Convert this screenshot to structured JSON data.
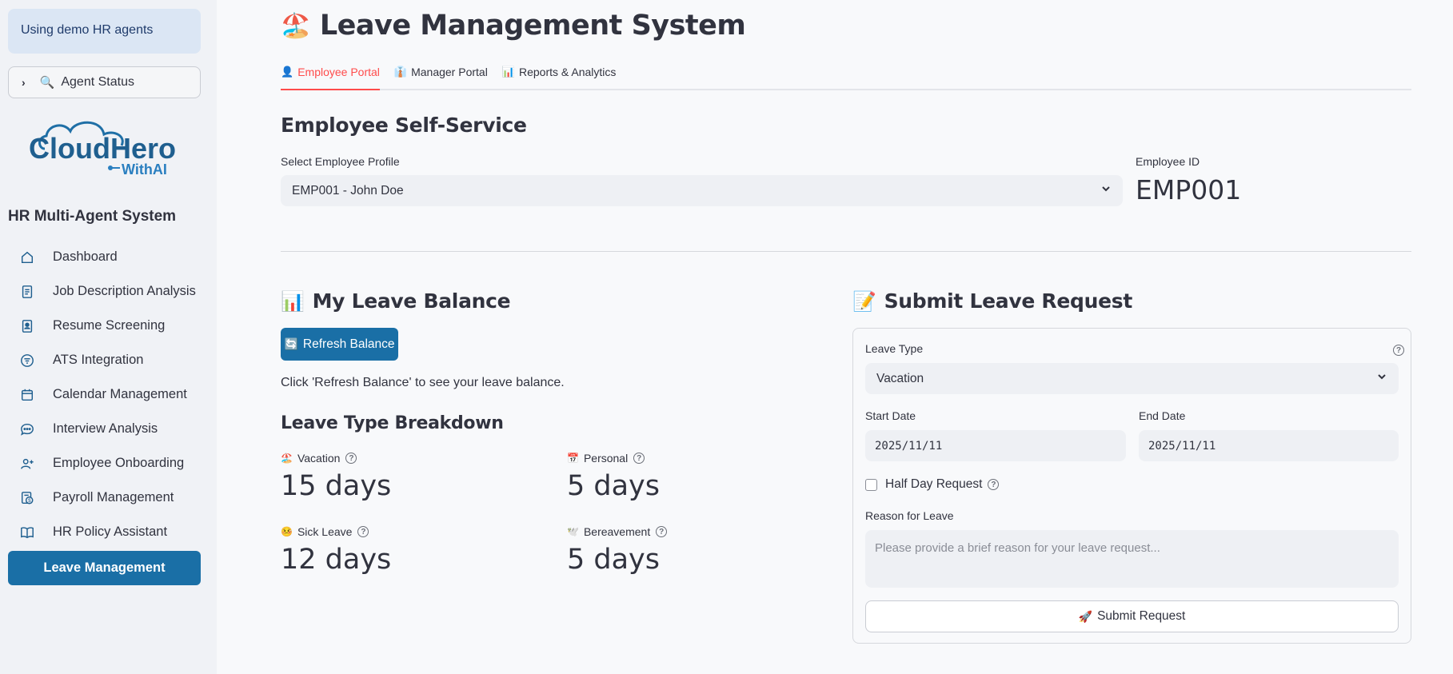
{
  "sidebar": {
    "demo_notice": "Using demo HR agents",
    "agent_status_label": "Agent Status",
    "logo": {
      "main": "CloudHero",
      "sub": "WithAI"
    },
    "system_title": "HR Multi-Agent System",
    "items": [
      {
        "label": "Dashboard",
        "icon": "home-icon"
      },
      {
        "label": "Job Description Analysis",
        "icon": "document-icon"
      },
      {
        "label": "Resume Screening",
        "icon": "id-badge-icon"
      },
      {
        "label": "ATS Integration",
        "icon": "filter-icon"
      },
      {
        "label": "Calendar Management",
        "icon": "calendar-icon"
      },
      {
        "label": "Interview Analysis",
        "icon": "chat-bubble-icon"
      },
      {
        "label": "Employee Onboarding",
        "icon": "user-add-icon"
      },
      {
        "label": "Payroll Management",
        "icon": "payroll-icon"
      },
      {
        "label": "HR Policy Assistant",
        "icon": "book-icon"
      },
      {
        "label": "Leave Management",
        "icon": "",
        "active": true
      }
    ]
  },
  "header": {
    "title": "Leave Management System",
    "title_emoji": "🏖️"
  },
  "tabs": [
    {
      "label": "Employee Portal",
      "emoji": "👤",
      "active": true
    },
    {
      "label": "Manager Portal",
      "emoji": "👔",
      "active": false
    },
    {
      "label": "Reports & Analytics",
      "emoji": "📊",
      "active": false
    }
  ],
  "self_service": {
    "heading": "Employee Self-Service",
    "profile_label": "Select Employee Profile",
    "profile_value": "EMP001 - John Doe",
    "employee_id_label": "Employee ID",
    "employee_id_value": "EMP001"
  },
  "balance": {
    "heading": "My Leave Balance",
    "heading_emoji": "📊",
    "refresh_button": "Refresh Balance",
    "refresh_emoji": "🔄",
    "hint": "Click 'Refresh Balance' to see your leave balance.",
    "breakdown_heading": "Leave Type Breakdown",
    "metrics": [
      {
        "label": "Vacation",
        "emoji": "🏖️",
        "value": "15 days"
      },
      {
        "label": "Personal",
        "emoji": "📅",
        "value": "5 days"
      },
      {
        "label": "Sick Leave",
        "emoji": "🤒",
        "value": "12 days"
      },
      {
        "label": "Bereavement",
        "emoji": "🕊️",
        "value": "5 days"
      }
    ]
  },
  "request": {
    "heading": "Submit Leave Request",
    "heading_emoji": "📝",
    "leave_type_label": "Leave Type",
    "leave_type_value": "Vacation",
    "start_label": "Start Date",
    "start_value": "2025/11/11",
    "end_label": "End Date",
    "end_value": "2025/11/11",
    "half_day_label": "Half Day Request",
    "reason_label": "Reason for Leave",
    "reason_placeholder": "Please provide a brief reason for your leave request...",
    "submit_button": "Submit Request",
    "submit_emoji": "🚀"
  }
}
